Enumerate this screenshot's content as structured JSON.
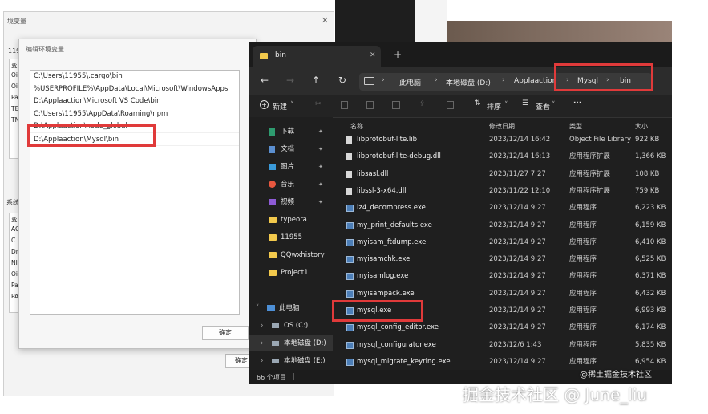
{
  "bg_dialog": {
    "title": "境变量",
    "close": "✕",
    "section_letters_1": [
      "11955",
      "变",
      "Oi",
      "Oi",
      "Pa",
      "TE",
      "TN"
    ],
    "section_label_2": "系统",
    "section_letters_2": [
      "变",
      "AC",
      "C",
      "Dr",
      "NI",
      "Oi",
      "Pa",
      "PA"
    ],
    "ok_label": "确定"
  },
  "edit_dialog": {
    "title": "编辑环境变量",
    "paths": [
      "C:\\Users\\11955\\.cargo\\bin",
      "%USERPROFILE%\\AppData\\Local\\Microsoft\\WindowsApps",
      "D:\\Applaaction\\Microsoft VS Code\\bin",
      "C:\\Users\\11955\\AppData\\Roaming\\npm",
      "D:\\Applaaction\\node_global",
      "D:\\Applaaction\\Mysql\\bin"
    ],
    "ok_label": "确定"
  },
  "explorer": {
    "tab_title": "bin",
    "tab_close": "✕",
    "tab_add": "+",
    "breadcrumb": [
      "此电脑",
      "本地磁盘 (D:)",
      "Applaaction",
      "Mysql",
      "bin"
    ],
    "toolbar": {
      "new_label": "新建",
      "sort_label": "排序",
      "view_label": "查看",
      "more_label": "···"
    },
    "columns": {
      "name": "名称",
      "date": "修改日期",
      "type": "类型",
      "size": "大小"
    },
    "sidebar": [
      {
        "label": "下载",
        "icon": "download-icon",
        "pinned": true
      },
      {
        "label": "文档",
        "icon": "document-icon",
        "pinned": true
      },
      {
        "label": "图片",
        "icon": "picture-icon",
        "pinned": true
      },
      {
        "label": "音乐",
        "icon": "music-icon",
        "pinned": true
      },
      {
        "label": "视频",
        "icon": "video-icon",
        "pinned": true
      },
      {
        "label": "typeora",
        "icon": "folder-icon",
        "pinned": false
      },
      {
        "label": "11955",
        "icon": "folder-icon",
        "pinned": false
      },
      {
        "label": "QQwxhistory",
        "icon": "folder-icon",
        "pinned": false
      },
      {
        "label": "Project1",
        "icon": "folder-icon",
        "pinned": false
      },
      {
        "label": "此电脑",
        "icon": "computer-icon",
        "pinned": false
      },
      {
        "label": "OS (C:)",
        "icon": "drive-icon",
        "pinned": false
      },
      {
        "label": "本地磁盘 (D:)",
        "icon": "drive-icon",
        "pinned": false
      },
      {
        "label": "本地磁盘 (E:)",
        "icon": "drive-icon",
        "pinned": false
      }
    ],
    "files": [
      {
        "name": "libprotobuf-lite.lib",
        "date": "2023/12/14 16:42",
        "type": "Object File Library",
        "size": "922 KB"
      },
      {
        "name": "libprotobuf-lite-debug.dll",
        "date": "2023/12/14 16:13",
        "type": "应用程序扩展",
        "size": "1,366 KB"
      },
      {
        "name": "libsasl.dll",
        "date": "2023/11/27 7:27",
        "type": "应用程序扩展",
        "size": "108 KB"
      },
      {
        "name": "libssl-3-x64.dll",
        "date": "2023/11/22 12:10",
        "type": "应用程序扩展",
        "size": "759 KB"
      },
      {
        "name": "lz4_decompress.exe",
        "date": "2023/12/14 9:27",
        "type": "应用程序",
        "size": "6,223 KB"
      },
      {
        "name": "my_print_defaults.exe",
        "date": "2023/12/14 9:27",
        "type": "应用程序",
        "size": "6,159 KB"
      },
      {
        "name": "myisam_ftdump.exe",
        "date": "2023/12/14 9:27",
        "type": "应用程序",
        "size": "6,410 KB"
      },
      {
        "name": "myisamchk.exe",
        "date": "2023/12/14 9:27",
        "type": "应用程序",
        "size": "6,525 KB"
      },
      {
        "name": "myisamlog.exe",
        "date": "2023/12/14 9:27",
        "type": "应用程序",
        "size": "6,371 KB"
      },
      {
        "name": "myisampack.exe",
        "date": "2023/12/14 9:27",
        "type": "应用程序",
        "size": "6,432 KB"
      },
      {
        "name": "mysql.exe",
        "date": "2023/12/14 9:27",
        "type": "应用程序",
        "size": "6,993 KB"
      },
      {
        "name": "mysql_config_editor.exe",
        "date": "2023/12/14 9:27",
        "type": "应用程序",
        "size": "6,174 KB"
      },
      {
        "name": "mysql_configurator.exe",
        "date": "2023/12/6 1:43",
        "type": "应用程序",
        "size": "5,835 KB"
      },
      {
        "name": "mysql_migrate_keyring.exe",
        "date": "2023/12/14 9:27",
        "type": "应用程序",
        "size": "6,954 KB"
      }
    ],
    "status": "66 个项目"
  },
  "watermark_small": "@稀土掘金技术社区",
  "watermark_large": "掘金技术社区 @ June_liu",
  "colors": {
    "highlight": "#e03a3a",
    "explorer_bg": "#1f1f1f",
    "folder": "#f2c94c"
  }
}
